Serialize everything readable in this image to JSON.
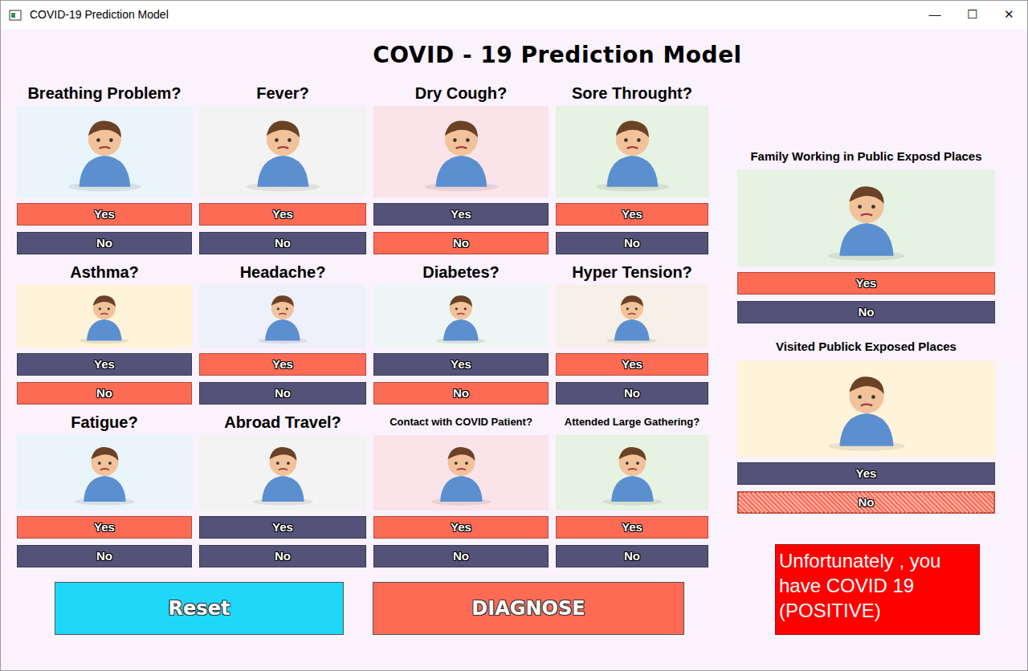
{
  "window": {
    "title": "COVID-19 Prediction Model",
    "controls": [
      "—",
      "☐",
      "✕"
    ]
  },
  "heading": "COVID - 19 Prediction Model",
  "questions": [
    {
      "label": "Breathing Problem?",
      "options": [
        {
          "label": "Yes",
          "selected": true,
          "focused": false
        },
        {
          "label": "No",
          "selected": false,
          "focused": false
        }
      ]
    },
    {
      "label": "Fever?",
      "options": [
        {
          "label": "Yes",
          "selected": true,
          "focused": false
        },
        {
          "label": "No",
          "selected": false,
          "focused": false
        }
      ]
    },
    {
      "label": "Dry Cough?",
      "options": [
        {
          "label": "Yes",
          "selected": false,
          "focused": false
        },
        {
          "label": "No",
          "selected": true,
          "focused": false
        }
      ]
    },
    {
      "label": "Sore Throught?",
      "options": [
        {
          "label": "Yes",
          "selected": true,
          "focused": false
        },
        {
          "label": "No",
          "selected": false,
          "focused": false
        }
      ]
    },
    {
      "label": "Asthma?",
      "options": [
        {
          "label": "Yes",
          "selected": false,
          "focused": false
        },
        {
          "label": "No",
          "selected": true,
          "focused": false
        }
      ]
    },
    {
      "label": "Headache?",
      "options": [
        {
          "label": "Yes",
          "selected": true,
          "focused": false
        },
        {
          "label": "No",
          "selected": false,
          "focused": false
        }
      ]
    },
    {
      "label": "Diabetes?",
      "options": [
        {
          "label": "Yes",
          "selected": false,
          "focused": false
        },
        {
          "label": "No",
          "selected": true,
          "focused": false
        }
      ]
    },
    {
      "label": "Hyper Tension?",
      "options": [
        {
          "label": "Yes",
          "selected": true,
          "focused": false
        },
        {
          "label": "No",
          "selected": false,
          "focused": false
        }
      ]
    },
    {
      "label": "Fatigue?",
      "options": [
        {
          "label": "Yes",
          "selected": true,
          "focused": false
        },
        {
          "label": "No",
          "selected": false,
          "focused": false
        }
      ]
    },
    {
      "label": "Abroad Travel?",
      "options": [
        {
          "label": "Yes",
          "selected": false,
          "focused": false
        },
        {
          "label": "No",
          "selected": false,
          "focused": false
        }
      ]
    },
    {
      "label": "Contact with COVID Patient?",
      "options": [
        {
          "label": "Yes",
          "selected": true,
          "focused": false
        },
        {
          "label": "No",
          "selected": false,
          "focused": false
        }
      ]
    },
    {
      "label": "Attended Large Gathering?",
      "options": [
        {
          "label": "Yes",
          "selected": true,
          "focused": false
        },
        {
          "label": "No",
          "selected": false,
          "focused": false
        }
      ]
    }
  ],
  "exposure": [
    {
      "label": "Family Working in Public Exposd Places",
      "options": [
        {
          "label": "Yes",
          "selected": true,
          "focused": false
        },
        {
          "label": "No",
          "selected": false,
          "focused": false
        }
      ]
    },
    {
      "label": "Visited Publick Exposed Places",
      "options": [
        {
          "label": "Yes",
          "selected": false,
          "focused": false
        },
        {
          "label": "No",
          "selected": true,
          "focused": true
        }
      ]
    }
  ],
  "actions": [
    "Reset",
    "DIAGNOSE"
  ],
  "result": "Unfortunately , you have COVID 19 (POSITIVE)"
}
